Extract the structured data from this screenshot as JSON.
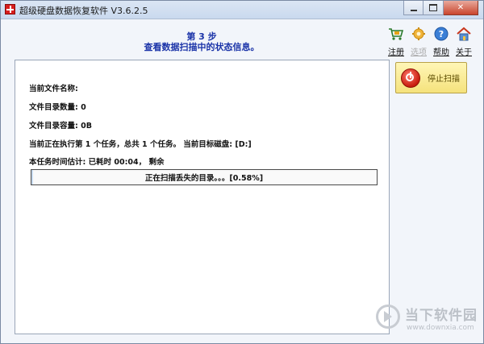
{
  "window": {
    "title": "超级硬盘数据恢复软件 V3.6.2.5"
  },
  "header": {
    "step_title": "第 3 步",
    "step_subtitle": "查看数据扫描中的状态信息。"
  },
  "toolbar": {
    "items": [
      {
        "label": "注册",
        "icon": "cart-icon",
        "enabled": true
      },
      {
        "label": "选项",
        "icon": "gear-icon",
        "enabled": false
      },
      {
        "label": "帮助",
        "icon": "help-icon",
        "enabled": true
      },
      {
        "label": "关于",
        "icon": "home-icon",
        "enabled": true
      }
    ]
  },
  "status": {
    "current_file": "当前文件名称:",
    "dir_count": "文件目录数量:  0",
    "dir_size": "文件目录容量:  0B",
    "task_info": "当前正在执行第 1 个任务，总共 1 个任务。 当前目标磁盘: [D:]",
    "time_estimate": "本任务时间估计:  已耗时 00:04， 剩余"
  },
  "progress": {
    "text": "正在扫描丢失的目录。。。[0.58%]",
    "percent": 0.58
  },
  "actions": {
    "stop_label": "停止扫描"
  },
  "watermark": {
    "brand": "当下软件园",
    "url": "www.downxia.com"
  },
  "colors": {
    "heading_blue": "#1a33a8",
    "stop_button_yellow": "#f5e27c",
    "stop_icon_red": "#c81d0f"
  }
}
